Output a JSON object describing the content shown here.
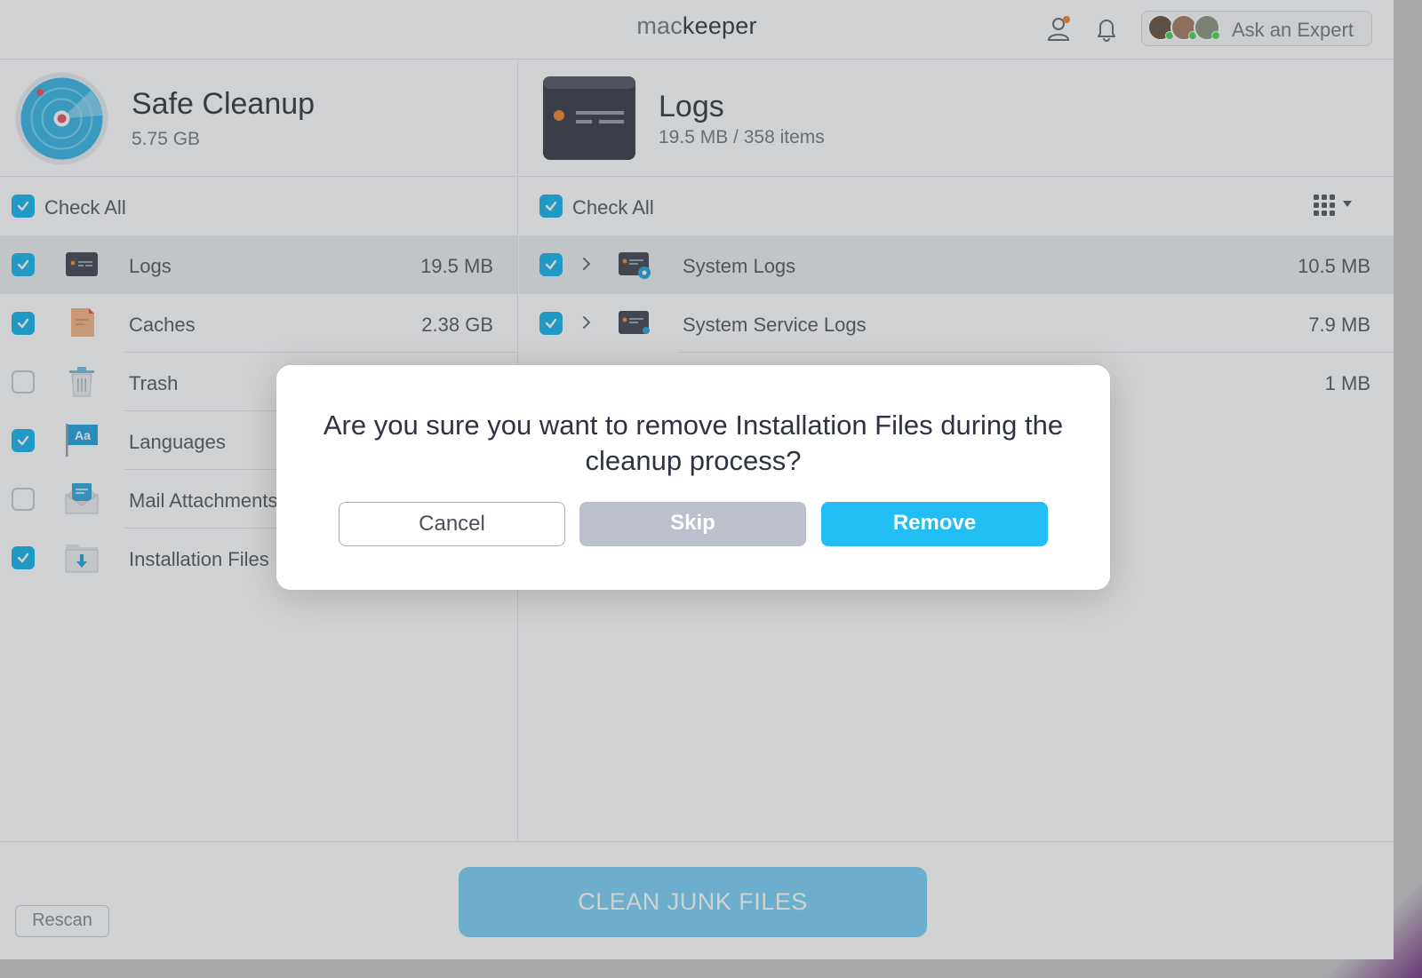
{
  "app": {
    "brand_prefix": "mac",
    "brand_suffix": "keeper"
  },
  "topbar": {
    "expert_label": "Ask an Expert"
  },
  "left": {
    "title": "Safe Cleanup",
    "subtitle": "5.75 GB",
    "check_all": "Check All",
    "items": [
      {
        "label": "Logs",
        "size": "19.5 MB",
        "checked": true
      },
      {
        "label": "Caches",
        "size": "2.38 GB",
        "checked": true
      },
      {
        "label": "Trash",
        "size": "",
        "checked": false
      },
      {
        "label": "Languages",
        "size": "",
        "checked": true
      },
      {
        "label": "Mail Attachments",
        "size": "",
        "checked": false
      },
      {
        "label": "Installation Files",
        "size": "",
        "checked": true
      }
    ]
  },
  "right": {
    "title": "Logs",
    "subtitle": "19.5 MB / 358 items",
    "check_all": "Check All",
    "items": [
      {
        "label": "System Logs",
        "size": "10.5 MB",
        "checked": true
      },
      {
        "label": "System Service Logs",
        "size": "7.9 MB",
        "checked": true
      },
      {
        "label": "",
        "size": "1 MB",
        "checked": true
      }
    ]
  },
  "bottom": {
    "rescan": "Rescan",
    "clean": "CLEAN JUNK FILES"
  },
  "dialog": {
    "message": "Are you sure you want to remove Installation Files during the cleanup process?",
    "cancel": "Cancel",
    "skip": "Skip",
    "remove": "Remove"
  },
  "colors": {
    "accent": "#22bdf3",
    "check": "#1fb8ef",
    "skip": "#bcbfcc"
  }
}
